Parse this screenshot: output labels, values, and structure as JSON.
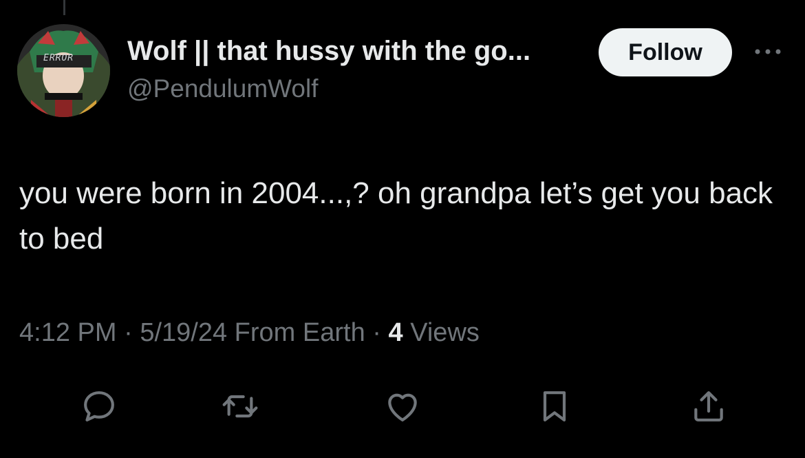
{
  "author": {
    "display_name": "Wolf || that hussy with the go...",
    "handle": "@PendulumWolf",
    "avatar_badge_text": "ERROR"
  },
  "header": {
    "follow_label": "Follow",
    "more_icon": "more-horizontal-icon"
  },
  "tweet": {
    "text": "you were born in 2004...,? oh grandpa let’s get you back to bed"
  },
  "meta": {
    "time": "4:12 PM",
    "separator": " · ",
    "date": "5/19/24",
    "source": "From Earth",
    "views_count": "4",
    "views_label": "Views"
  },
  "actions": [
    {
      "name": "reply",
      "icon": "reply-icon"
    },
    {
      "name": "retweet",
      "icon": "retweet-icon"
    },
    {
      "name": "like",
      "icon": "heart-icon"
    },
    {
      "name": "bookmark",
      "icon": "bookmark-icon"
    },
    {
      "name": "share",
      "icon": "share-icon"
    }
  ],
  "colors": {
    "background": "#000000",
    "primary_text": "#e7e9ea",
    "secondary_text": "#71767b",
    "follow_bg": "#eff3f4",
    "follow_text": "#0f1419"
  }
}
